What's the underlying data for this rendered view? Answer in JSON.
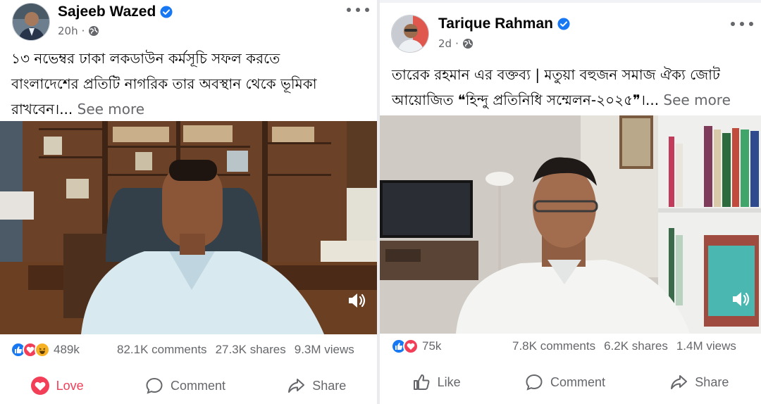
{
  "left_post": {
    "author": "Sajeeb Wazed",
    "time": "20h",
    "caption_lines": [
      "১৩ নভেম্বর ঢাকা লকডাউন কর্মসূচি সফল করতে",
      "বাংলাদেশের প্রতিটি নাগরিক তার অবস্থান থেকে ভূমিকা",
      "রাখবেন।..."
    ],
    "see_more": "See more",
    "reaction_count": "489k",
    "comments": "82.1K comments",
    "shares": "27.3K shares",
    "views": "9.3M views",
    "actions": {
      "love": "Love",
      "comment": "Comment",
      "share": "Share"
    },
    "love_color": "#f33e58"
  },
  "right_post": {
    "author": "Tarique Rahman",
    "time": "2d",
    "caption_lines": [
      "তারেক রহমান এর বক্তব্য | মতুয়া বহুজন সমাজ ঐক্য জোট",
      "আয়োজিত ❝হিন্দু প্রতিনিধি সম্মেলন-২০২৫❞।..."
    ],
    "see_more": "See more",
    "reaction_count": "75k",
    "comments": "7.8K comments",
    "shares": "6.2K shares",
    "views": "1.4M views",
    "actions": {
      "like": "Like",
      "comment": "Comment",
      "share": "Share"
    }
  },
  "colors": {
    "verified": "#1877f2",
    "like_blue": "#1877f2",
    "love_red": "#f33e58",
    "haha_yellow": "#f7b125",
    "secondary_text": "#65676b"
  },
  "icons": [
    "verified-badge-icon",
    "globe-icon",
    "more-options-icon",
    "sound-icon",
    "like-reaction-icon",
    "love-reaction-icon",
    "haha-reaction-icon",
    "love-icon",
    "like-icon",
    "comment-icon",
    "share-icon"
  ]
}
